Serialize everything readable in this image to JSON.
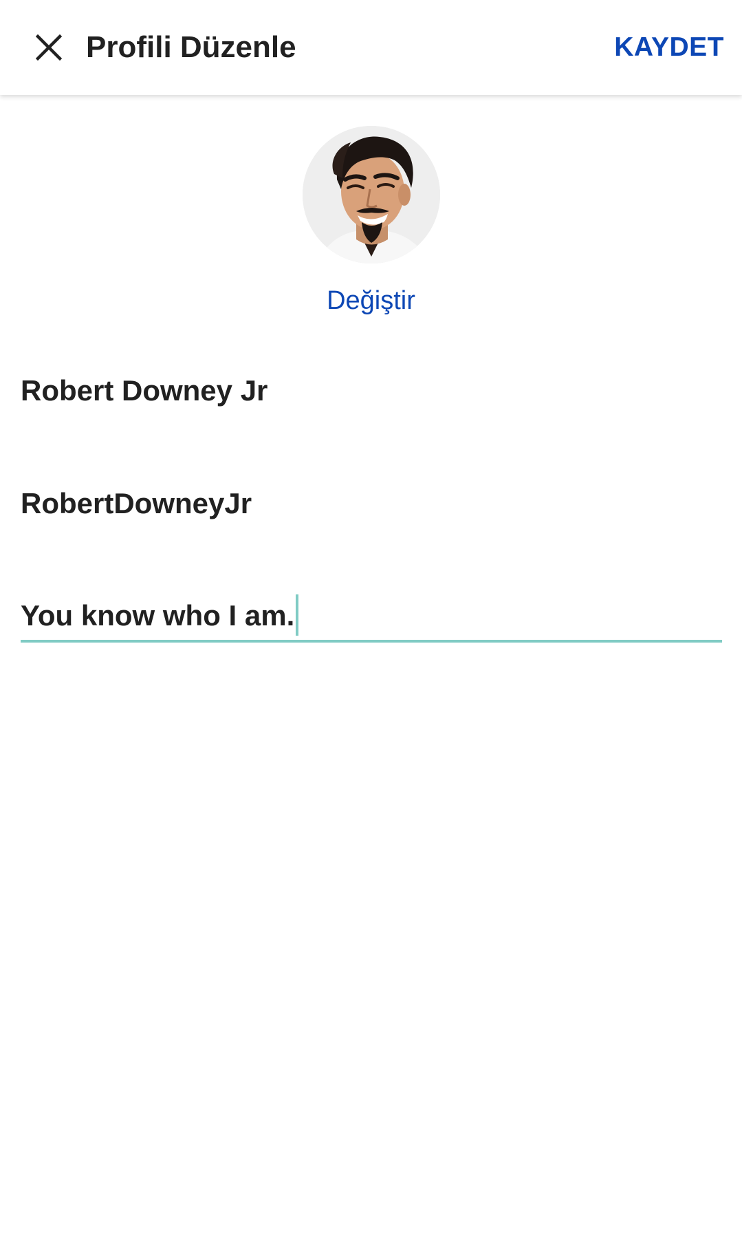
{
  "header": {
    "title": "Profili Düzenle",
    "save_label": "KAYDET",
    "close_icon": "close-icon"
  },
  "profile": {
    "avatar_icon": "profile-photo",
    "change_photo_label": "Değiştir",
    "name": "Robert Downey Jr",
    "username": "RobertDowneyJr",
    "bio": "You know who I am."
  },
  "colors": {
    "accent_blue": "#0d47b5",
    "focus_teal": "#80cbc4",
    "text_primary": "#212121"
  }
}
